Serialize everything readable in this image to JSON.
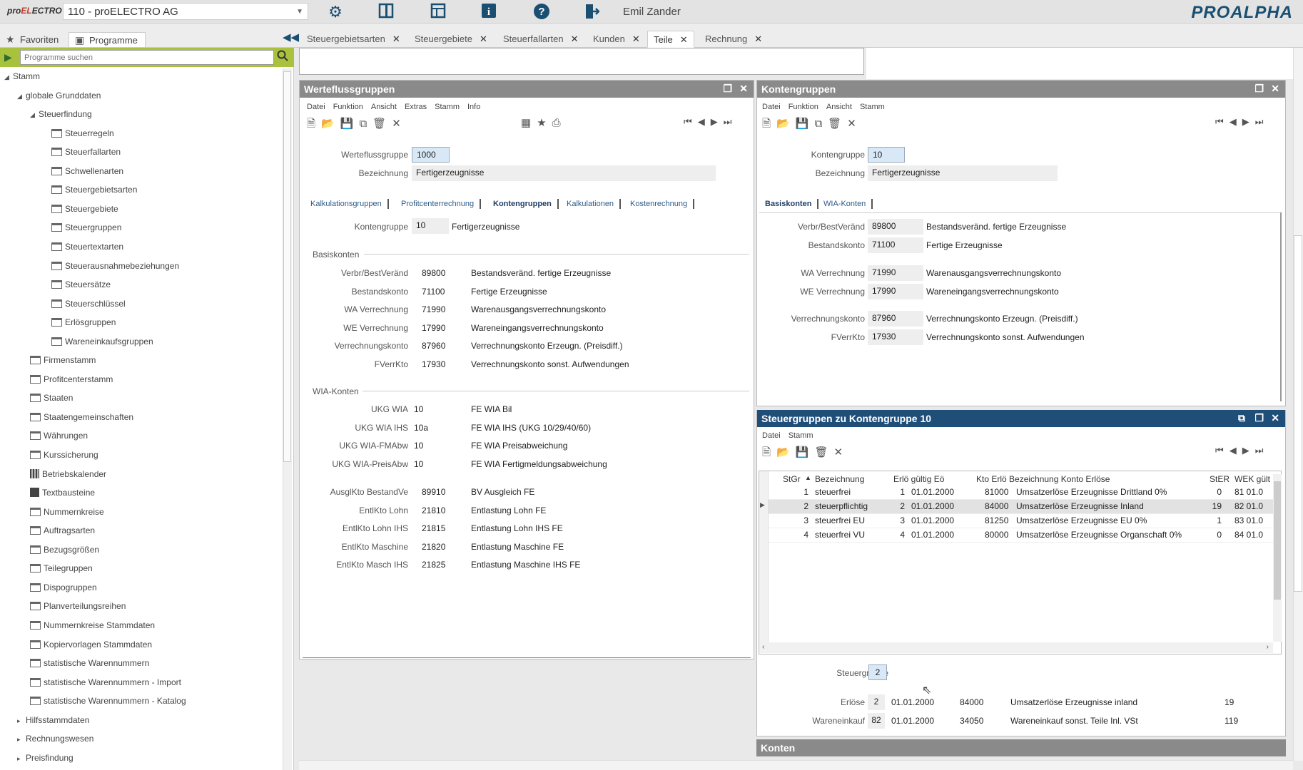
{
  "app": {
    "logo": "proELECTRO",
    "company": "110 - proELECTRO AG",
    "user": "Emil Zander",
    "brand": "PROALPHA"
  },
  "top_icons": [
    "gear-icon",
    "panel-icon",
    "layout-icon",
    "info-icon",
    "help-icon",
    "exit-icon"
  ],
  "left_tabs": [
    {
      "label": "Favoriten"
    },
    {
      "label": "Programme"
    }
  ],
  "doc_tabs": [
    {
      "label": "Steuergebietsarten"
    },
    {
      "label": "Steuergebiete"
    },
    {
      "label": "Steuerfallarten"
    },
    {
      "label": "Kunden"
    },
    {
      "label": "Teile"
    },
    {
      "label": "Rechnung"
    }
  ],
  "search": {
    "placeholder": "Programme suchen"
  },
  "tree": [
    {
      "label": "Stamm",
      "level": 0,
      "type": "expanded"
    },
    {
      "label": "globale Grunddaten",
      "level": 1,
      "type": "expanded"
    },
    {
      "label": "Steuerfindung",
      "level": 2,
      "type": "expanded"
    },
    {
      "label": "Steuerregeln",
      "level": 3,
      "type": "box"
    },
    {
      "label": "Steuerfallarten",
      "level": 3,
      "type": "box"
    },
    {
      "label": "Schwellenarten",
      "level": 3,
      "type": "box"
    },
    {
      "label": "Steuergebietsarten",
      "level": 3,
      "type": "box"
    },
    {
      "label": "Steuergebiete",
      "level": 3,
      "type": "box"
    },
    {
      "label": "Steuergruppen",
      "level": 3,
      "type": "box"
    },
    {
      "label": "Steuertextarten",
      "level": 3,
      "type": "box"
    },
    {
      "label": "Steuerausnahmebeziehungen",
      "level": 3,
      "type": "box"
    },
    {
      "label": "Steuersätze",
      "level": 3,
      "type": "box"
    },
    {
      "label": "Steuerschlüssel",
      "level": 3,
      "type": "box"
    },
    {
      "label": "Erlösgruppen",
      "level": 3,
      "type": "box"
    },
    {
      "label": "Wareneinkaufsgruppen",
      "level": 3,
      "type": "box"
    },
    {
      "label": "Firmenstamm",
      "level": 2,
      "type": "box"
    },
    {
      "label": "Profitcenterstamm",
      "level": 2,
      "type": "box"
    },
    {
      "label": "Staaten",
      "level": 2,
      "type": "box"
    },
    {
      "label": "Staatengemeinschaften",
      "level": 2,
      "type": "box"
    },
    {
      "label": "Währungen",
      "level": 2,
      "type": "box"
    },
    {
      "label": "Kurssicherung",
      "level": 2,
      "type": "box"
    },
    {
      "label": "Betriebskalender",
      "level": 2,
      "type": "cal"
    },
    {
      "label": "Textbausteine",
      "level": 2,
      "type": "doc"
    },
    {
      "label": "Nummernkreise",
      "level": 2,
      "type": "box"
    },
    {
      "label": "Auftragsarten",
      "level": 2,
      "type": "box"
    },
    {
      "label": "Bezugsgrößen",
      "level": 2,
      "type": "box"
    },
    {
      "label": "Teilegruppen",
      "level": 2,
      "type": "box"
    },
    {
      "label": "Dispogruppen",
      "level": 2,
      "type": "box"
    },
    {
      "label": "Planverteilungsreihen",
      "level": 2,
      "type": "box"
    },
    {
      "label": "Nummernkreise Stammdaten",
      "level": 2,
      "type": "box"
    },
    {
      "label": "Kopiervorlagen Stammdaten",
      "level": 2,
      "type": "box"
    },
    {
      "label": "statistische Warennummern",
      "level": 2,
      "type": "box"
    },
    {
      "label": "statistische Warennummern - Import",
      "level": 2,
      "type": "box"
    },
    {
      "label": "statistische Warennummern - Katalog",
      "level": 2,
      "type": "box"
    },
    {
      "label": "Hilfsstammdaten",
      "level": 1,
      "type": "collapsed"
    },
    {
      "label": "Rechnungswesen",
      "level": 1,
      "type": "collapsed"
    },
    {
      "label": "Preisfindung",
      "level": 1,
      "type": "collapsed"
    }
  ],
  "wfg": {
    "title": "Werteflussgruppen",
    "menu": [
      "Datei",
      "Funktion",
      "Ansicht",
      "Extras",
      "Stamm",
      "Info"
    ],
    "wfg_label": "Werteflussgruppe",
    "wfg_value": "1000",
    "bez_label": "Bezeichnung",
    "bez_value": "Fertigerzeugnisse",
    "tabs": [
      "Kalkulationsgruppen",
      "Profitcenterrechnung",
      "Kontengruppen",
      "Kalkulationen",
      "Kostenrechnung"
    ],
    "kg_label": "Kontengruppe",
    "kg_value": "10",
    "kg_text": "Fertigerzeugnisse",
    "basis_title": "Basiskonten",
    "basis": [
      {
        "l": "Verbr/BestVeränd",
        "n": "89800",
        "t": "Bestandsveränd. fertige Erzeugnisse"
      },
      {
        "l": "Bestandskonto",
        "n": "71100",
        "t": "Fertige Erzeugnisse"
      },
      {
        "l": "WA Verrechnung",
        "n": "71990",
        "t": "Warenausgangsverrechnungskonto"
      },
      {
        "l": "WE Verrechnung",
        "n": "17990",
        "t": "Wareneingangsverrechnungskonto"
      },
      {
        "l": "Verrechnungskonto",
        "n": "87960",
        "t": "Verrechnungskonto Erzeugn. (Preisdiff.)"
      },
      {
        "l": "FVerrKto",
        "n": "17930",
        "t": "Verrechnungskonto sonst. Aufwendungen"
      }
    ],
    "wia_title": "WIA-Konten",
    "wia": [
      {
        "l": "UKG WIA",
        "n": "10",
        "t": "FE WIA Bil"
      },
      {
        "l": "UKG WIA IHS",
        "n": "10a",
        "t": "FE WIA IHS (UKG 10/29/40/60)"
      },
      {
        "l": "UKG WIA-FMAbw",
        "n": "10",
        "t": "FE WIA Preisabweichung"
      },
      {
        "l": "UKG WIA-PreisAbw",
        "n": "10",
        "t": "FE WIA Fertigmeldungsabweichung"
      }
    ],
    "other": [
      {
        "l": "AusglKto BestandVe",
        "n": "89910",
        "t": "BV Ausgleich FE"
      },
      {
        "l": "EntlKto Lohn",
        "n": "21810",
        "t": "Entlastung Lohn FE"
      },
      {
        "l": "EntlKto Lohn IHS",
        "n": "21815",
        "t": "Entlastung Lohn IHS FE"
      },
      {
        "l": "EntlKto Maschine",
        "n": "21820",
        "t": "Entlastung Maschine FE"
      },
      {
        "l": "EntlKto Masch IHS",
        "n": "21825",
        "t": "Entlastung Maschine IHS FE"
      }
    ]
  },
  "kg": {
    "title": "Kontengruppen",
    "menu": [
      "Datei",
      "Funktion",
      "Ansicht",
      "Stamm"
    ],
    "kg_label": "Kontengruppe",
    "kg_value": "10",
    "bez_label": "Bezeichnung",
    "bez_value": "Fertigerzeugnisse",
    "tabs": [
      "Basiskonten",
      "WIA-Konten"
    ],
    "rows": [
      {
        "l": "Verbr/BestVeränd",
        "n": "89800",
        "t": "Bestandsveränd. fertige Erzeugnisse"
      },
      {
        "l": "Bestandskonto",
        "n": "71100",
        "t": "Fertige Erzeugnisse"
      },
      {
        "l": "WA Verrechnung",
        "n": "71990",
        "t": "Warenausgangsverrechnungskonto"
      },
      {
        "l": "WE Verrechnung",
        "n": "17990",
        "t": "Wareneingangsverrechnungskonto"
      },
      {
        "l": "Verrechnungskonto",
        "n": "87960",
        "t": "Verrechnungskonto Erzeugn. (Preisdiff.)"
      },
      {
        "l": "FVerrKto",
        "n": "17930",
        "t": "Verrechnungskonto sonst. Aufwendungen"
      }
    ]
  },
  "stg": {
    "title": "Steuergruppen zu Kontengruppe 10",
    "menu": [
      "Datei",
      "Stamm"
    ],
    "headers": [
      "StGr",
      "Bezeichnung",
      "Erlö gültig Eö",
      "Kto Erlö Bezeichnung Konto Erlöse",
      "StER",
      "WEK gült"
    ],
    "rows": [
      {
        "stgr": "1",
        "bez": "steuerfrei",
        "erl": "1",
        "date": "01.01.2000",
        "kto": "81000",
        "kbez": "Umsatzerlöse Erzeugnisse Drittland 0%",
        "ster": "0",
        "wek": "81 01.0"
      },
      {
        "stgr": "2",
        "bez": "steuerpflichtig",
        "erl": "2",
        "date": "01.01.2000",
        "kto": "84000",
        "kbez": "Umsatzerlöse Erzeugnisse Inland",
        "ster": "19",
        "wek": "82 01.0"
      },
      {
        "stgr": "3",
        "bez": "steuerfrei EU",
        "erl": "3",
        "date": "01.01.2000",
        "kto": "81250",
        "kbez": "Umsatzerlöse Erzeugnisse EU 0%",
        "ster": "1",
        "wek": "83 01.0"
      },
      {
        "stgr": "4",
        "bez": "steuerfrei VU",
        "erl": "4",
        "date": "01.01.2000",
        "kto": "80000",
        "kbez": "Umsatzerlöse Erzeugnisse Organschaft 0%",
        "ster": "0",
        "wek": "84 01.0"
      }
    ],
    "sg_label": "Steuergruppe",
    "sg_value": "2",
    "detail": [
      {
        "l": "Erlöse",
        "a": "2",
        "d": "01.01.2000",
        "k": "84000",
        "t": "Umsatzerlöse Erzeugnisse inland",
        "n": "19"
      },
      {
        "l": "Wareneinkauf",
        "a": "82",
        "d": "01.01.2000",
        "k": "34050",
        "t": "Wareneinkauf sonst. Teile Inl. VSt",
        "n": "119"
      }
    ]
  },
  "konten": {
    "title": "Konten"
  }
}
